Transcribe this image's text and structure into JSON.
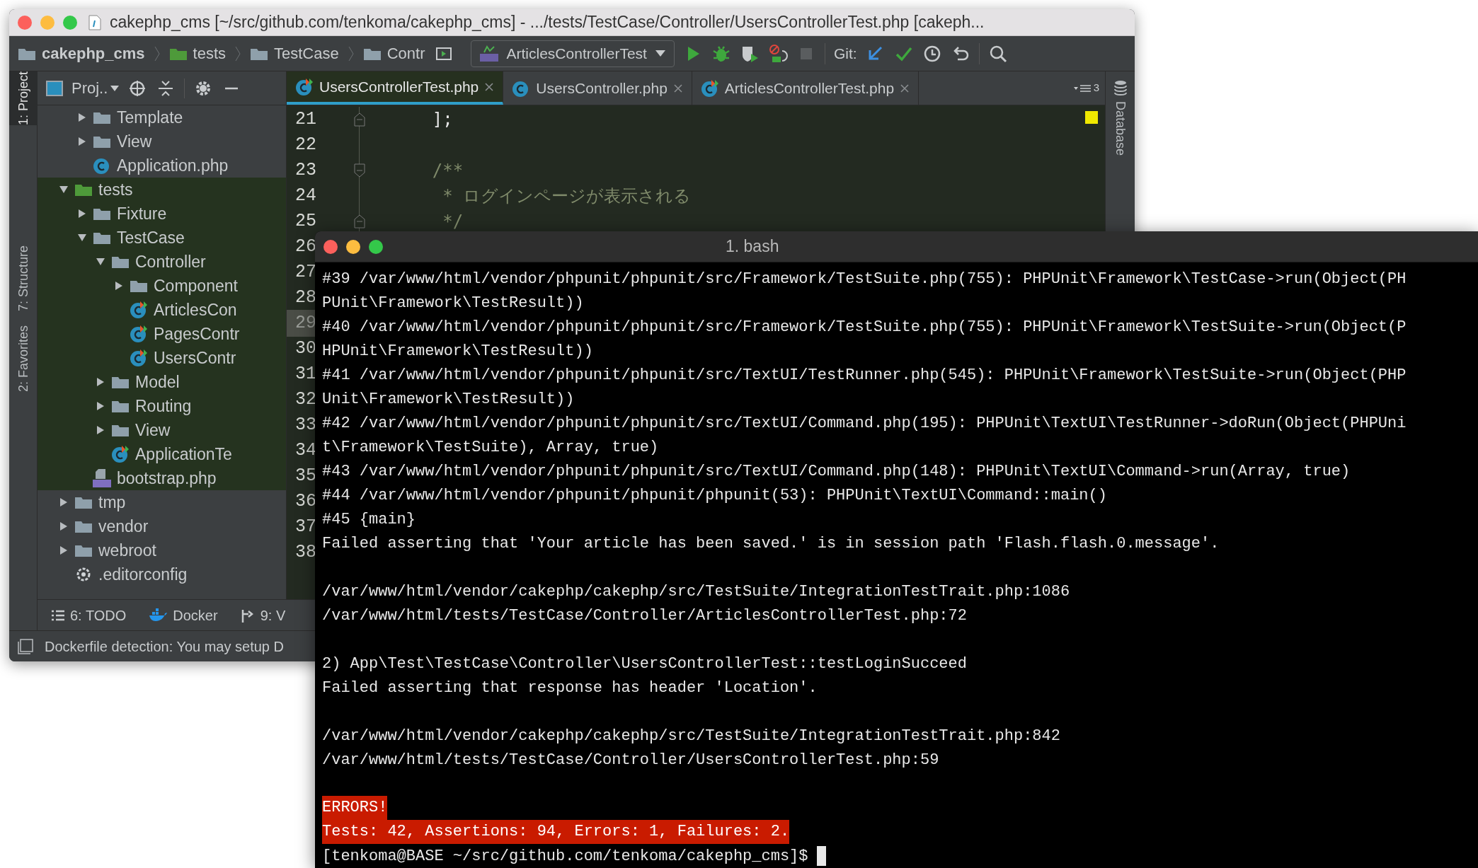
{
  "window": {
    "title": "cakephp_cms [~/src/github.com/tenkoma/cakephp_cms] - .../tests/TestCase/Controller/UsersControllerTest.php [cakeph..."
  },
  "toolbar": {
    "breadcrumbs": [
      {
        "label": "cakephp_cms",
        "kind": "project"
      },
      {
        "label": "tests",
        "kind": "test-folder"
      },
      {
        "label": "TestCase",
        "kind": "folder"
      },
      {
        "label": "Contr",
        "kind": "folder"
      }
    ],
    "run_config": "ArticlesControllerTest",
    "vcs_label": "Git:"
  },
  "side_tabs": [
    {
      "label": "1: Project",
      "selected": true
    },
    {
      "label": "7: Structure",
      "selected": false
    },
    {
      "label": "2: Favorites",
      "selected": false
    }
  ],
  "project": {
    "title": "Proj..",
    "above": [
      {
        "label": "Template",
        "kind": "folder",
        "expanded": false
      },
      {
        "label": "View",
        "kind": "folder",
        "expanded": false
      },
      {
        "label": "Application.php",
        "kind": "php-class"
      }
    ],
    "tree": [
      {
        "label": "tests",
        "kind": "test-folder",
        "expanded": true,
        "test_root": true,
        "children": [
          {
            "label": "Fixture",
            "kind": "folder",
            "expanded": false
          },
          {
            "label": "TestCase",
            "kind": "folder",
            "expanded": true,
            "children": [
              {
                "label": "Controller",
                "kind": "folder",
                "expanded": true,
                "children": [
                  {
                    "label": "Component",
                    "kind": "folder",
                    "expanded": false
                  },
                  {
                    "label": "ArticlesCon",
                    "kind": "php-test"
                  },
                  {
                    "label": "PagesContr",
                    "kind": "php-test"
                  },
                  {
                    "label": "UsersContr",
                    "kind": "php-test"
                  }
                ]
              },
              {
                "label": "Model",
                "kind": "folder",
                "expanded": false
              },
              {
                "label": "Routing",
                "kind": "folder",
                "expanded": false
              },
              {
                "label": "View",
                "kind": "folder",
                "expanded": false
              },
              {
                "label": "ApplicationTe",
                "kind": "php-test"
              }
            ]
          },
          {
            "label": "bootstrap.php",
            "kind": "php-file"
          }
        ]
      },
      {
        "label": "tmp",
        "kind": "folder",
        "expanded": false
      },
      {
        "label": "vendor",
        "kind": "folder",
        "expanded": false
      },
      {
        "label": "webroot",
        "kind": "folder",
        "expanded": false
      },
      {
        "label": ".editorconfig",
        "kind": "config"
      }
    ]
  },
  "editor": {
    "tabs": [
      {
        "label": "UsersControllerTest.php",
        "kind": "php-test",
        "selected": true
      },
      {
        "label": "UsersController.php",
        "kind": "php-class",
        "selected": false
      },
      {
        "label": "ArticlesControllerTest.php",
        "kind": "php-test",
        "selected": false
      }
    ],
    "tab_count": "3",
    "lines": [
      {
        "number": "21",
        "code": "    ];",
        "kind": "code",
        "fold_start": false,
        "fold_end": true,
        "current": false
      },
      {
        "number": "22",
        "current": false
      },
      {
        "number": "23",
        "code": "    /**",
        "kind": "comment",
        "fold_start": true,
        "fold_end": false,
        "current": false
      },
      {
        "number": "24",
        "code": "     * ログインページが表示される",
        "kind": "comment",
        "fold_start": false,
        "fold_end": false,
        "current": false
      },
      {
        "number": "25",
        "code": "     */",
        "kind": "comment",
        "fold_start": false,
        "fold_end": true,
        "current": false
      },
      {
        "number": "26",
        "current": false
      },
      {
        "number": "27",
        "current": false
      },
      {
        "number": "28",
        "current": false
      },
      {
        "number": "29",
        "current": true
      },
      {
        "number": "30",
        "current": false
      },
      {
        "number": "31",
        "current": false
      },
      {
        "number": "32",
        "current": false
      },
      {
        "number": "33",
        "current": false
      },
      {
        "number": "34",
        "current": false
      },
      {
        "number": "35",
        "current": false
      },
      {
        "number": "36",
        "current": false
      },
      {
        "number": "37",
        "current": false
      },
      {
        "number": "38",
        "current": false
      }
    ]
  },
  "right_tabs": [
    "Database"
  ],
  "tool_windows": [
    {
      "label": "6: TODO",
      "kind": "todo"
    },
    {
      "label": "Docker",
      "kind": "docker"
    },
    {
      "label": "9: V",
      "kind": "vcs"
    }
  ],
  "status": "Dockerfile detection: You may setup D",
  "terminal": {
    "title": "1. bash",
    "lines": [
      {
        "kind": "text",
        "text": "#39 /var/www/html/vendor/phpunit/phpunit/src/Framework/TestSuite.php(755): PHPUnit\\Framework\\TestCase->run(Object(PH"
      },
      {
        "kind": "text",
        "text": "PUnit\\Framework\\TestResult))"
      },
      {
        "kind": "text",
        "text": "#40 /var/www/html/vendor/phpunit/phpunit/src/Framework/TestSuite.php(755): PHPUnit\\Framework\\TestSuite->run(Object(P"
      },
      {
        "kind": "text",
        "text": "HPUnit\\Framework\\TestResult))"
      },
      {
        "kind": "text",
        "text": "#41 /var/www/html/vendor/phpunit/phpunit/src/TextUI/TestRunner.php(545): PHPUnit\\Framework\\TestSuite->run(Object(PHP"
      },
      {
        "kind": "text",
        "text": "Unit\\Framework\\TestResult))"
      },
      {
        "kind": "text",
        "text": "#42 /var/www/html/vendor/phpunit/phpunit/src/TextUI/Command.php(195): PHPUnit\\TextUI\\TestRunner->doRun(Object(PHPUni"
      },
      {
        "kind": "text",
        "text": "t\\Framework\\TestSuite), Array, true)"
      },
      {
        "kind": "text",
        "text": "#43 /var/www/html/vendor/phpunit/phpunit/src/TextUI/Command.php(148): PHPUnit\\TextUI\\Command->run(Array, true)"
      },
      {
        "kind": "text",
        "text": "#44 /var/www/html/vendor/phpunit/phpunit/phpunit(53): PHPUnit\\TextUI\\Command::main()"
      },
      {
        "kind": "text",
        "text": "#45 {main}"
      },
      {
        "kind": "text",
        "text": "Failed asserting that 'Your article has been saved.' is in session path 'Flash.flash.0.message'."
      },
      {
        "kind": "blank"
      },
      {
        "kind": "text",
        "text": "/var/www/html/vendor/cakephp/cakephp/src/TestSuite/IntegrationTestTrait.php:1086"
      },
      {
        "kind": "text",
        "text": "/var/www/html/tests/TestCase/Controller/ArticlesControllerTest.php:72"
      },
      {
        "kind": "blank"
      },
      {
        "kind": "text",
        "text": "2) App\\Test\\TestCase\\Controller\\UsersControllerTest::testLoginSucceed"
      },
      {
        "kind": "text",
        "text": "Failed asserting that response has header 'Location'."
      },
      {
        "kind": "blank"
      },
      {
        "kind": "text",
        "text": "/var/www/html/vendor/cakephp/cakephp/src/TestSuite/IntegrationTestTrait.php:842"
      },
      {
        "kind": "text",
        "text": "/var/www/html/tests/TestCase/Controller/UsersControllerTest.php:59"
      },
      {
        "kind": "blank"
      },
      {
        "kind": "error",
        "text": "ERRORS!"
      },
      {
        "kind": "error",
        "text": "Tests: 42, Assertions: 94, Errors: 1, Failures: 2."
      },
      {
        "kind": "prompt",
        "text": "[tenkoma@BASE ~/src/github.com/tenkoma/cakephp_cms]$"
      }
    ]
  }
}
